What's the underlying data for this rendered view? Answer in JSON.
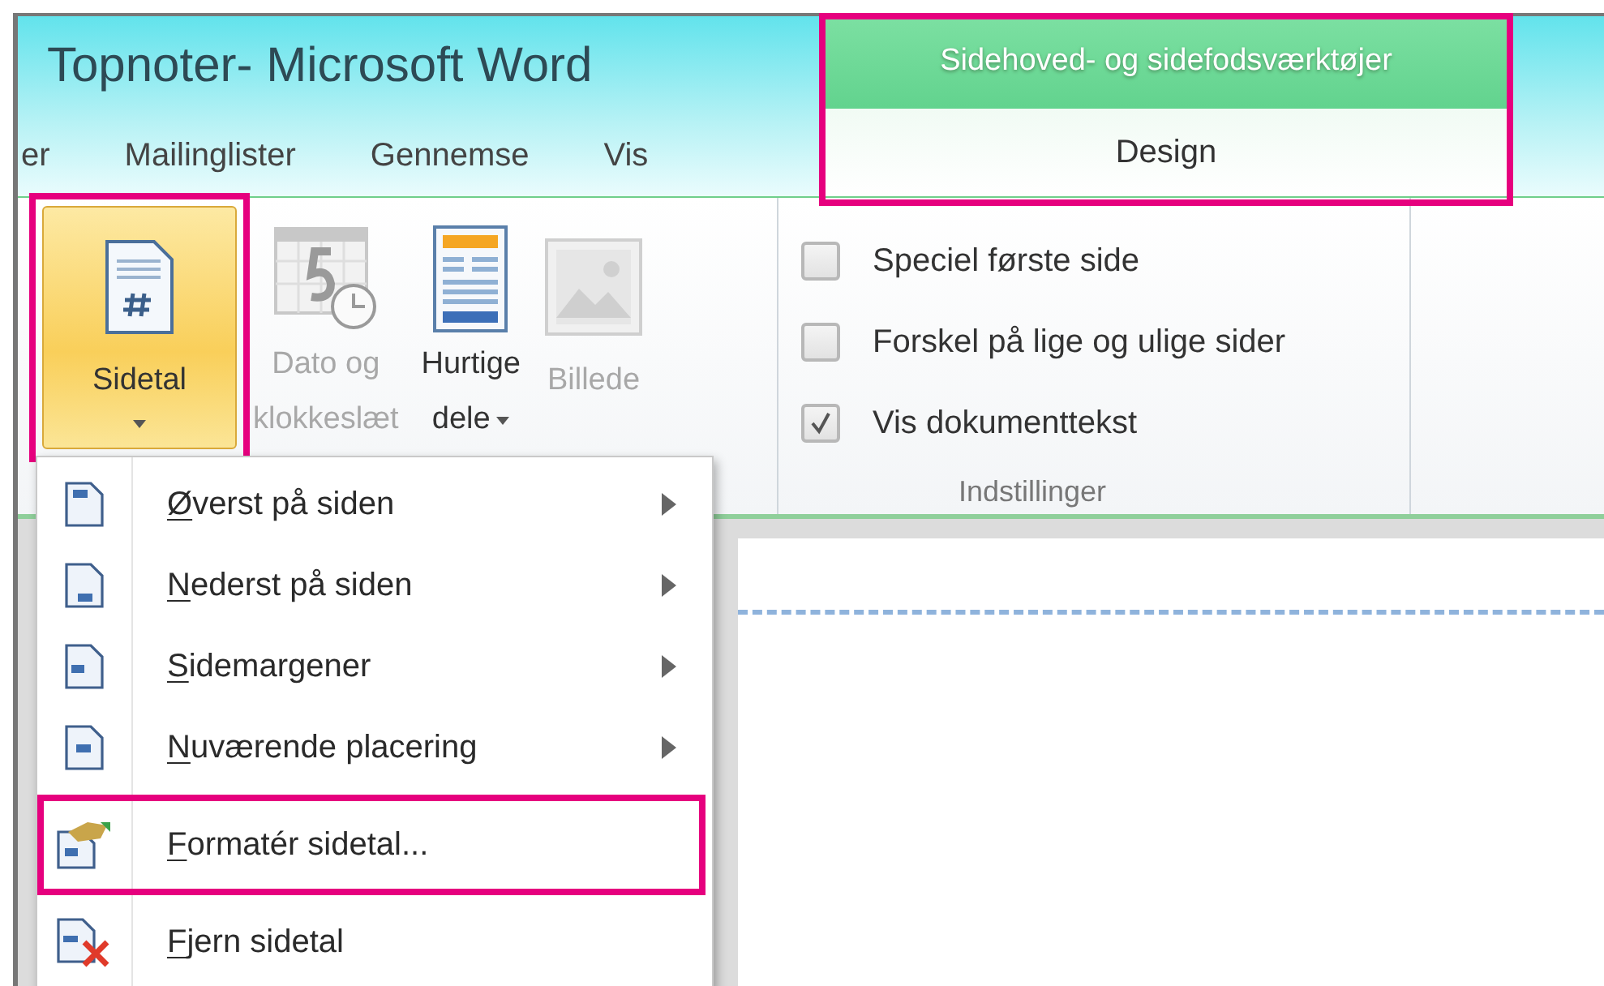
{
  "window": {
    "title": "Topnoter- Microsoft Word"
  },
  "tabs": [
    {
      "label": "er",
      "selected": false
    },
    {
      "label": "Mailinglister",
      "selected": false
    },
    {
      "label": "Gennemse",
      "selected": false
    },
    {
      "label": "Vis",
      "selected": false
    }
  ],
  "contextual_tab_group": {
    "title": "Sidehoved- og sidefodsværktøjer",
    "highlighted": true,
    "tabs": [
      {
        "label": "Design",
        "selected": true
      }
    ]
  },
  "ribbon": {
    "insert_group": {
      "buttons": [
        {
          "label_lines": [
            "Sidetal"
          ],
          "kind": "page-number",
          "disabled": false,
          "pressed": true,
          "dropdown": true,
          "highlighted": true
        },
        {
          "label_lines": [
            "Dato og",
            "klokkeslæt"
          ],
          "kind": "date-time",
          "disabled": true,
          "pressed": false,
          "dropdown": false,
          "highlighted": false
        },
        {
          "label_lines": [
            "Hurtige",
            "dele"
          ],
          "kind": "quick-parts",
          "disabled": false,
          "pressed": false,
          "dropdown": true,
          "highlighted": false
        },
        {
          "label_lines": [
            "Billede"
          ],
          "kind": "picture",
          "disabled": true,
          "pressed": false,
          "dropdown": false,
          "highlighted": false
        }
      ]
    },
    "options_group": {
      "label": "Indstillinger",
      "checkboxes": [
        {
          "label": "Speciel første side",
          "checked": false
        },
        {
          "label": "Forskel på lige og ulige sider",
          "checked": false
        },
        {
          "label": "Vis dokumenttekst",
          "checked": true
        }
      ]
    }
  },
  "menu": {
    "items": [
      {
        "label": "Øverst på siden",
        "kind": "top",
        "submenu": true,
        "highlighted": false
      },
      {
        "label": "Nederst på siden",
        "kind": "bottom",
        "submenu": true,
        "highlighted": false
      },
      {
        "label": "Sidemargener",
        "kind": "margin",
        "submenu": true,
        "highlighted": false
      },
      {
        "label": "Nuværende placering",
        "kind": "current",
        "submenu": true,
        "highlighted": false
      },
      {
        "label": "Formatér sidetal...",
        "kind": "format",
        "submenu": false,
        "highlighted": true
      },
      {
        "label": "Fjern sidetal",
        "kind": "remove",
        "submenu": false,
        "highlighted": false
      }
    ]
  }
}
